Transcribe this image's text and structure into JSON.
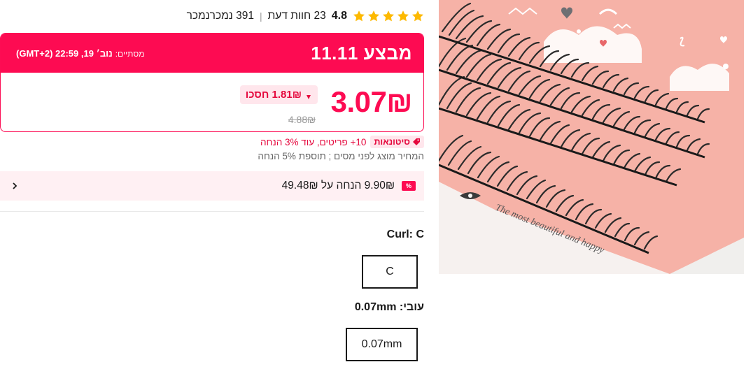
{
  "rating": {
    "value": "4.8",
    "reviews": "23 חוות דעת",
    "separator": "|",
    "sold": "391 נמכרנמכר"
  },
  "deal": {
    "title": "מבצע 11.11",
    "timer_label": "מסתיים:",
    "timer_value": "נוב׳ 19, 22:59 (GMT+2)",
    "price": "3.07₪",
    "save": "1.81₪ חסכו",
    "old_price": "4.88₪"
  },
  "bulk": {
    "badge": "סיטונאות",
    "text": "10+ פריטים, עוד 3% הנחה"
  },
  "tax_note": "המחיר מוצג לפני מסים ; תוספת 5% הנחה",
  "coupon": {
    "icon_text": "%",
    "text": "9.90₪ הנחה על 49.48₪"
  },
  "options": {
    "curl": {
      "label": "Curl:",
      "value": "C",
      "choice": "C"
    },
    "thickness": {
      "label": "עובי:",
      "value": "0.07mm",
      "choice": "0.07mm"
    }
  },
  "image": {
    "caption": "The most beautiful and happy"
  },
  "colors": {
    "accent": "#fd0b52",
    "star": "#fdb900",
    "badge_bg": "#ffe6ec",
    "coupon_bg": "#fff0f3"
  },
  "icons": {
    "star": "star-icon",
    "save_arrow": "arrow-down-icon",
    "tag": "tag-icon",
    "chevron": "chevron-right-icon"
  }
}
